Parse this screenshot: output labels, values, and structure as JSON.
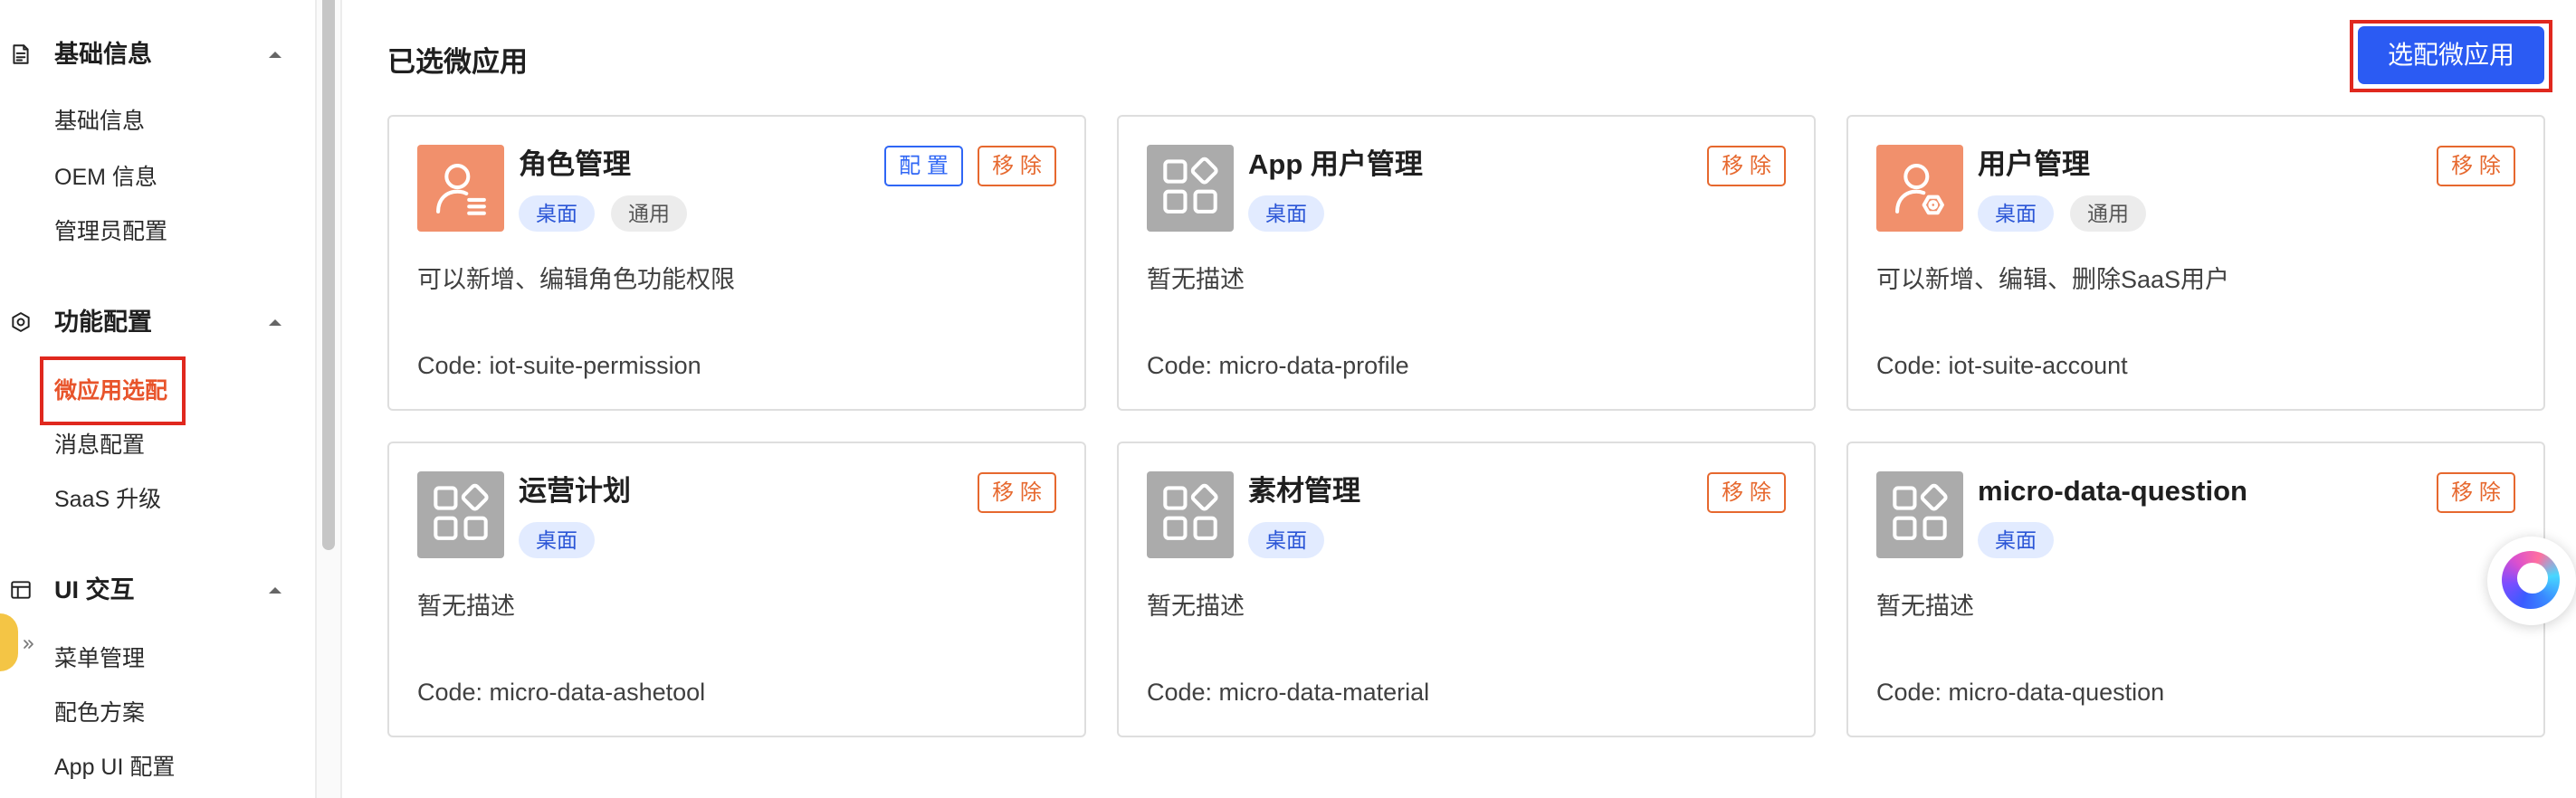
{
  "colors": {
    "primary": "#2B5BF3",
    "danger": "#E6682E",
    "highlight_outline": "#E0281E",
    "active_menu_text": "#E8542B",
    "icon_orange": "#F1906C",
    "icon_gray": "#ABABAB"
  },
  "sidebar": {
    "groups": [
      {
        "title": "基础信息",
        "icon": "document-icon",
        "expanded": true,
        "items": [
          "基础信息",
          "OEM 信息",
          "管理员配置"
        ]
      },
      {
        "title": "功能配置",
        "icon": "gear-icon",
        "expanded": true,
        "active_index": 0,
        "items": [
          "微应用选配",
          "消息配置",
          "SaaS 升级"
        ]
      },
      {
        "title": "UI 交互",
        "icon": "window-icon",
        "expanded": true,
        "items": [
          "菜单管理",
          "配色方案",
          "App UI 配置"
        ]
      }
    ]
  },
  "main": {
    "title": "已选微应用",
    "select_button": "选配微应用",
    "cards": [
      {
        "title": "角色管理",
        "icon": "role-management-icon",
        "icon_bg": "#F1906C",
        "tags": [
          {
            "label": "桌面",
            "bg": "#E2EBFF",
            "color": "#2A55D6"
          },
          {
            "label": "通用",
            "bg": "#ECECEC",
            "color": "#555555"
          }
        ],
        "actions": [
          {
            "label": "配 置",
            "color": "#2F66F5"
          },
          {
            "label": "移 除",
            "color": "#E6682E"
          }
        ],
        "description": "可以新增、编辑角色功能权限",
        "code": "Code: iot-suite-permission"
      },
      {
        "title": "App 用户管理",
        "icon": "app-grid-icon",
        "icon_bg": "#ABABAB",
        "tags": [
          {
            "label": "桌面",
            "bg": "#E2EBFF",
            "color": "#2A55D6"
          }
        ],
        "actions": [
          {
            "label": "移 除",
            "color": "#E6682E"
          }
        ],
        "description": "暂无描述",
        "code": "Code: micro-data-profile"
      },
      {
        "title": "用户管理",
        "icon": "user-management-icon",
        "icon_bg": "#F1906C",
        "tags": [
          {
            "label": "桌面",
            "bg": "#E2EBFF",
            "color": "#2A55D6"
          },
          {
            "label": "通用",
            "bg": "#ECECEC",
            "color": "#555555"
          }
        ],
        "actions": [
          {
            "label": "移 除",
            "color": "#E6682E"
          }
        ],
        "description": "可以新增、编辑、删除SaaS用户",
        "code": "Code: iot-suite-account"
      },
      {
        "title": "运营计划",
        "icon": "app-grid-icon",
        "icon_bg": "#ABABAB",
        "tags": [
          {
            "label": "桌面",
            "bg": "#E2EBFF",
            "color": "#2A55D6"
          }
        ],
        "actions": [
          {
            "label": "移 除",
            "color": "#E6682E"
          }
        ],
        "description": "暂无描述",
        "code": "Code: micro-data-ashetool"
      },
      {
        "title": "素材管理",
        "icon": "app-grid-icon",
        "icon_bg": "#ABABAB",
        "tags": [
          {
            "label": "桌面",
            "bg": "#E2EBFF",
            "color": "#2A55D6"
          }
        ],
        "actions": [
          {
            "label": "移 除",
            "color": "#E6682E"
          }
        ],
        "description": "暂无描述",
        "code": "Code: micro-data-material"
      },
      {
        "title": "micro-data-question",
        "icon": "app-grid-icon",
        "icon_bg": "#ABABAB",
        "tags": [
          {
            "label": "桌面",
            "bg": "#E2EBFF",
            "color": "#2A55D6"
          }
        ],
        "actions": [
          {
            "label": "移 除",
            "color": "#E6682E"
          }
        ],
        "description": "暂无描述",
        "code": "Code: micro-data-question"
      }
    ]
  },
  "floating": {
    "icon": "swirl-logo-icon"
  },
  "mascot": {
    "icon": "mascot-avatar",
    "toggle_icon": "double-chevron-right-icon"
  }
}
